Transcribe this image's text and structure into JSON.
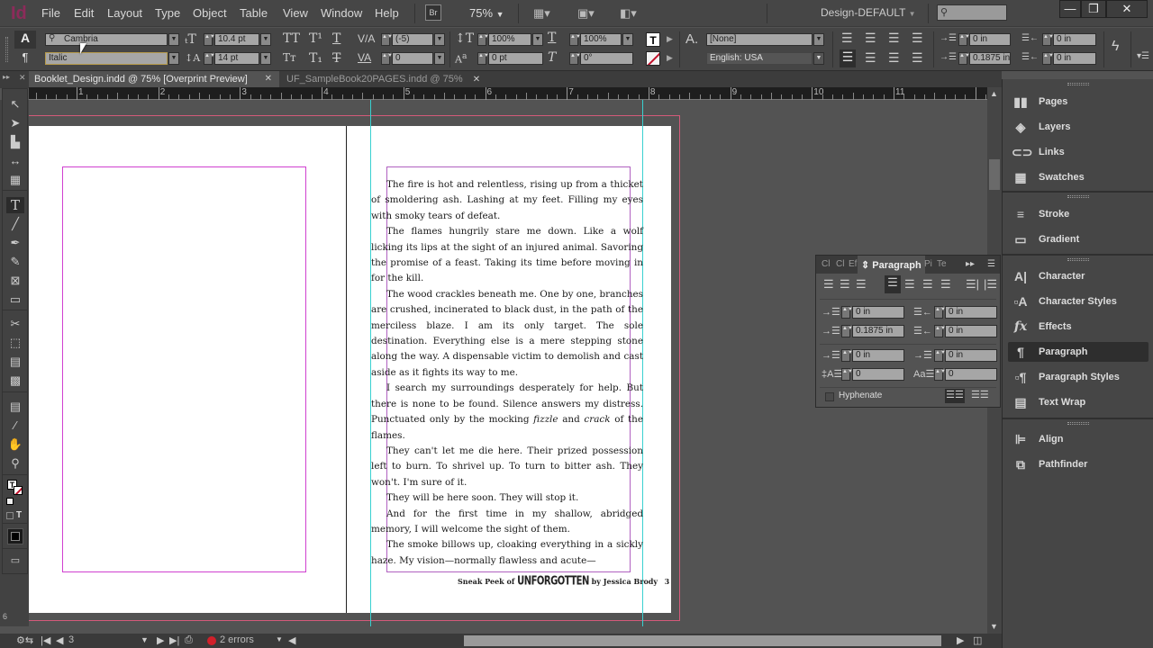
{
  "app": {
    "logo": "Id",
    "bridge_label": "Br",
    "zoom": "75%",
    "workspace": "Design-DEFAULT"
  },
  "menu": [
    "File",
    "Edit",
    "Layout",
    "Type",
    "Object",
    "Table",
    "View",
    "Window",
    "Help"
  ],
  "window_controls": {
    "minimize": "—",
    "restore": "❐",
    "close": "✕"
  },
  "control_panel": {
    "char_mode_icon": "A",
    "para_mode_icon": "¶",
    "font_family": "Cambria",
    "font_style": "Italic",
    "font_size": "10.4 pt",
    "leading": "14 pt",
    "kerning": "(-5)",
    "tracking": "0",
    "vertical_scale": "100%",
    "horizontal_scale": "100%",
    "baseline_shift": "0 pt",
    "skew": "0°",
    "char_style": "[None]",
    "language": "English: USA",
    "left_indent": "0 in",
    "right_indent": "0 in",
    "first_line_indent": "0.1875 in",
    "last_line_indent": "0 in"
  },
  "tabs": [
    {
      "label": "Booklet_Design.indd @ 75% [Overprint Preview]",
      "active": true
    },
    {
      "label": "UF_SampleBook20PAGES.indd @ 75%",
      "active": false
    }
  ],
  "ruler": {
    "labels": [
      "1",
      "2",
      "3",
      "4",
      "5",
      "6",
      "7",
      "8",
      "9",
      "10",
      "11"
    ]
  },
  "vruler": {
    "labels": [
      "6"
    ]
  },
  "page": {
    "paragraphs": [
      "The fire is hot and relentless, rising up from a thicket of smoldering ash. Lashing at my feet. Filling my eyes with smoky tears of defeat.",
      "The flames hungrily stare me down. Like a wolf licking its lips at the sight of an injured animal. Savoring the promise of a feast. Taking its time before moving in for the kill.",
      "The wood crackles beneath me. One by one, branches are crushed, incinerated to black dust, in the path of the merciless blaze. I am its only target. The sole destination. Everything else is a mere stepping stone along the way. A dispensable victim to demolish and cast aside as it fights its way to me."
    ],
    "p4": {
      "before": "I search my surroundings desperately for help. But there is none to be found. Silence answers my distress. Punctuated only by the mocking ",
      "italic1": "fizzle",
      "mid": " and ",
      "italic2": "crack",
      "after": " of the flames."
    },
    "paragraphs2": [
      "They can't let me die here. Their prized possession left to burn. To shrivel up. To turn to bitter ash. They won't. I'm sure of it.",
      "They will be here soon. They will stop it.",
      "And for the first time in my shallow, abridged memory, I will welcome the sight of them.",
      "The smoke billows up, cloaking everything in a sickly haze. My vision—normally flawless and acute—"
    ],
    "footer": {
      "prefix": "Sneak Peek of ",
      "title": "UNFORGOTTEN",
      "suffix": " by Jessica Brody",
      "page_number": "3"
    }
  },
  "paragraph_panel": {
    "tabs": [
      "Cl",
      "Cl",
      "Ef",
      "Paragraph",
      "Pi",
      "Te"
    ],
    "left_indent": "0 in",
    "right_indent": "0 in",
    "first_line_indent": "0.1875 in",
    "last_line_indent": "0 in",
    "space_before": "0 in",
    "space_after": "0 in",
    "drop_cap_lines": "0",
    "drop_cap_chars": "0",
    "hyphenate_label": "Hyphenate",
    "hyphenate_checked": false
  },
  "dock": {
    "group1": [
      {
        "label": "Pages",
        "icon": "▮▮"
      },
      {
        "label": "Layers",
        "icon": "◈"
      },
      {
        "label": "Links",
        "icon": "⊂⊃"
      },
      {
        "label": "Swatches",
        "icon": "▦"
      }
    ],
    "group2": [
      {
        "label": "Stroke",
        "icon": "≡"
      },
      {
        "label": "Gradient",
        "icon": "▭"
      }
    ],
    "group3": [
      {
        "label": "Character",
        "icon": "A|"
      },
      {
        "label": "Character Styles",
        "icon": "▫A"
      },
      {
        "label": "Effects",
        "icon": "fx"
      },
      {
        "label": "Paragraph",
        "icon": "¶"
      },
      {
        "label": "Paragraph Styles",
        "icon": "▫¶"
      },
      {
        "label": "Text Wrap",
        "icon": "▤"
      }
    ],
    "group4": [
      {
        "label": "Align",
        "icon": "⊫"
      },
      {
        "label": "Pathfinder",
        "icon": "⧉"
      }
    ]
  },
  "status": {
    "page": "3",
    "errors": "2 errors",
    "error_color": "#d0202a"
  }
}
